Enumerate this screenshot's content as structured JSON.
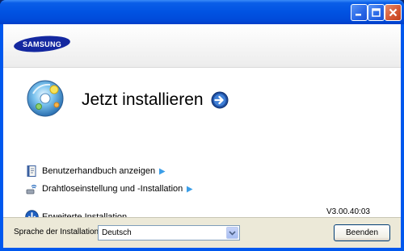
{
  "window": {
    "controls": [
      "minimize-icon",
      "maximize-icon",
      "close-icon"
    ]
  },
  "brand": {
    "logo_text": "SAMSUNG",
    "logo_color": "#1428a0"
  },
  "main": {
    "install_title": "Jetzt installieren",
    "links": [
      {
        "label": "Benutzerhandbuch anzeigen",
        "icon": "manual-book-icon"
      },
      {
        "label": "Drahtloseinstellung und -Installation",
        "icon": "wireless-icon"
      }
    ],
    "advanced_label": "Erweiterte Installation",
    "version": "V3.00.40:03"
  },
  "footer": {
    "language_label": "Sprache der Installation:",
    "language_value": "Deutsch",
    "close_button": "Beenden"
  },
  "colors": {
    "titlebar": "#0153e2",
    "accent_blue": "#1f5fbf",
    "link_arrow": "#3b9ee8"
  }
}
